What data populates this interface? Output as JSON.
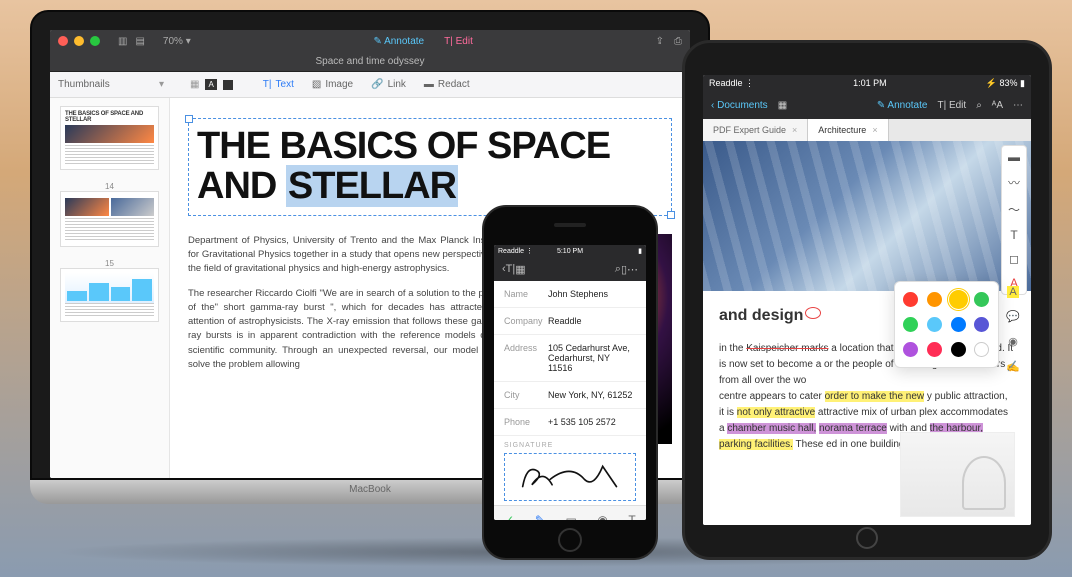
{
  "macbook": {
    "base_label": "MacBook",
    "titlebar": {
      "zoom": "70% ▾",
      "annotate": "Annotate",
      "edit": "Edit",
      "doc_title": "Space and time odyssey"
    },
    "toolbar": {
      "sidebar_label": "Thumbnails",
      "tabs": {
        "text": "Text",
        "image": "Image",
        "link": "Link",
        "redact": "Redact"
      }
    },
    "thumbnails": {
      "t1_title": "THE BASICS OF SPACE AND STELLAR",
      "n1": "14",
      "n2": "15"
    },
    "headline_line1": "THE BASICS OF SPACE",
    "headline_line2_a": "AND ",
    "headline_line2_b": "STELLAR",
    "para1": "Department of Physics, University of Trento and the Max Planck Institute for Gravitational Physics together in a study that opens new perspectives in the field of gravitational physics and high-energy astrophysics.",
    "para2": "The researcher Riccardo Ciolfi \"We are in search of a solution to the puzzle of the\" short gamma-ray burst \", which for decades has attracted the attention of astrophysicists. The X-ray emission that follows these gamma-ray bursts is in apparent contradiction with the reference models of the scientific community. Through an unexpected reversal, our model could solve the problem allowing"
  },
  "ipad": {
    "status": {
      "carrier": "Readdle ⋮",
      "time": "1:01 PM",
      "battery_pct": "83%"
    },
    "topbar": {
      "back": "Documents",
      "annotate": "Annotate",
      "edit": "Edit"
    },
    "tabs": {
      "t1": "PDF Expert Guide",
      "t2": "Architecture"
    },
    "article": {
      "title": "and design",
      "p1_pre": "in the ",
      "p1_strike": "Kaispeicher marks",
      "p1_post": " a location that most ever really noticed. It is now set to become a or the people of Hamburg and for visitors from all over the wo",
      "p2_pre": "centre appears to cater ",
      "p2_y1": "order to make the new",
      "p2_mid1": " y public attraction, it is ",
      "p2_y2": "not only attractive",
      "p2_mid2": " attractive mix of urban plex accommodates a ",
      "p2_pu1": "chamber music hall,",
      "p2_mid3": " ",
      "p2_pu2": "norama terrace",
      "p2_mid4": " with and ",
      "p2_pu3": "the harbour,",
      "p2_mid5": " ",
      "p2_y3": "parking facilities.",
      "p2_end": " These ed in one building as"
    },
    "colors": [
      "#ff3b30",
      "#ff9500",
      "#ffcc00",
      "#34c759",
      "#30d158",
      "#5ac8fa",
      "#007aff",
      "#5856d6",
      "#af52de",
      "#ff2d55",
      "#000000",
      "#ffffff"
    ]
  },
  "iphone": {
    "status": {
      "carrier": "Readdle ⋮",
      "time": "5:10 PM"
    },
    "form": {
      "name_label": "Name",
      "name_value": "John Stephens",
      "company_label": "Company",
      "company_value": "Readdle",
      "address_label": "Address",
      "address_value": "105 Cedarhurst Ave, Cedarhurst, NY 11516",
      "city_label": "City",
      "city_value": "New York, NY, 61252",
      "phone_label": "Phone",
      "phone_value": "+1 535 105 2572",
      "signature_label": "SIGNATURE"
    }
  }
}
